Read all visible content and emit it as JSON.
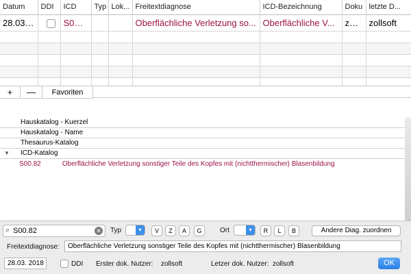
{
  "table": {
    "columns": [
      "Datum",
      "DDI",
      "ICD",
      "Typ",
      "Lok...",
      "Freitextdiagnose",
      "ICD-Bezeichnung",
      "Doku",
      "letzte D..."
    ],
    "row": {
      "datum": "28.03.18",
      "ddi_checked": false,
      "icd": "S00....",
      "typ": "",
      "lok": "",
      "freitext": "Oberflächliche Verletzung so...",
      "icd_bezeichnung": "Oberflächliche V...",
      "doku": "zoll...",
      "letzte": "zollsoft"
    },
    "buttons": {
      "add": "+",
      "remove": "—",
      "favorites": "Favoriten"
    }
  },
  "catalog": {
    "groups": [
      "Hauskatalog - Kuerzel",
      "Hauskatalog - Name",
      "Thesaurus-Katalog",
      "ICD-Katalog"
    ],
    "expanded_item": {
      "code": "S00.82",
      "text": "Oberflächliche Verletzung sonstiger Teile des Kopfes mit (nichtthermischer) Blasenbildung"
    }
  },
  "search": {
    "value": "S00.82",
    "typ_label": "Typ",
    "typ_buttons": [
      "V",
      "Z",
      "A",
      "G"
    ],
    "ort_label": "Ort",
    "ort_buttons": [
      "R",
      "L",
      "B"
    ],
    "assign_button": "Andere Diag. zuordnen"
  },
  "form": {
    "freitext_label": "Freitextdiagnose:",
    "freitext_value": "Oberflächliche Verletzung sonstiger Teile des Kopfes mit (nichtthermischer) Blasenbildung",
    "date_value": "28.03. 2018",
    "ddi_label": "DDI",
    "erster_label": "Erster dok. Nutzer:",
    "erster_value": "zollsoft",
    "letzter_label": "Letzer dok. Nutzer:",
    "letzter_value": "zollsoft",
    "ok_label": "OK"
  },
  "colors": {
    "accent": "#2a7fe6",
    "diagnosis_text": "#9c1048"
  }
}
